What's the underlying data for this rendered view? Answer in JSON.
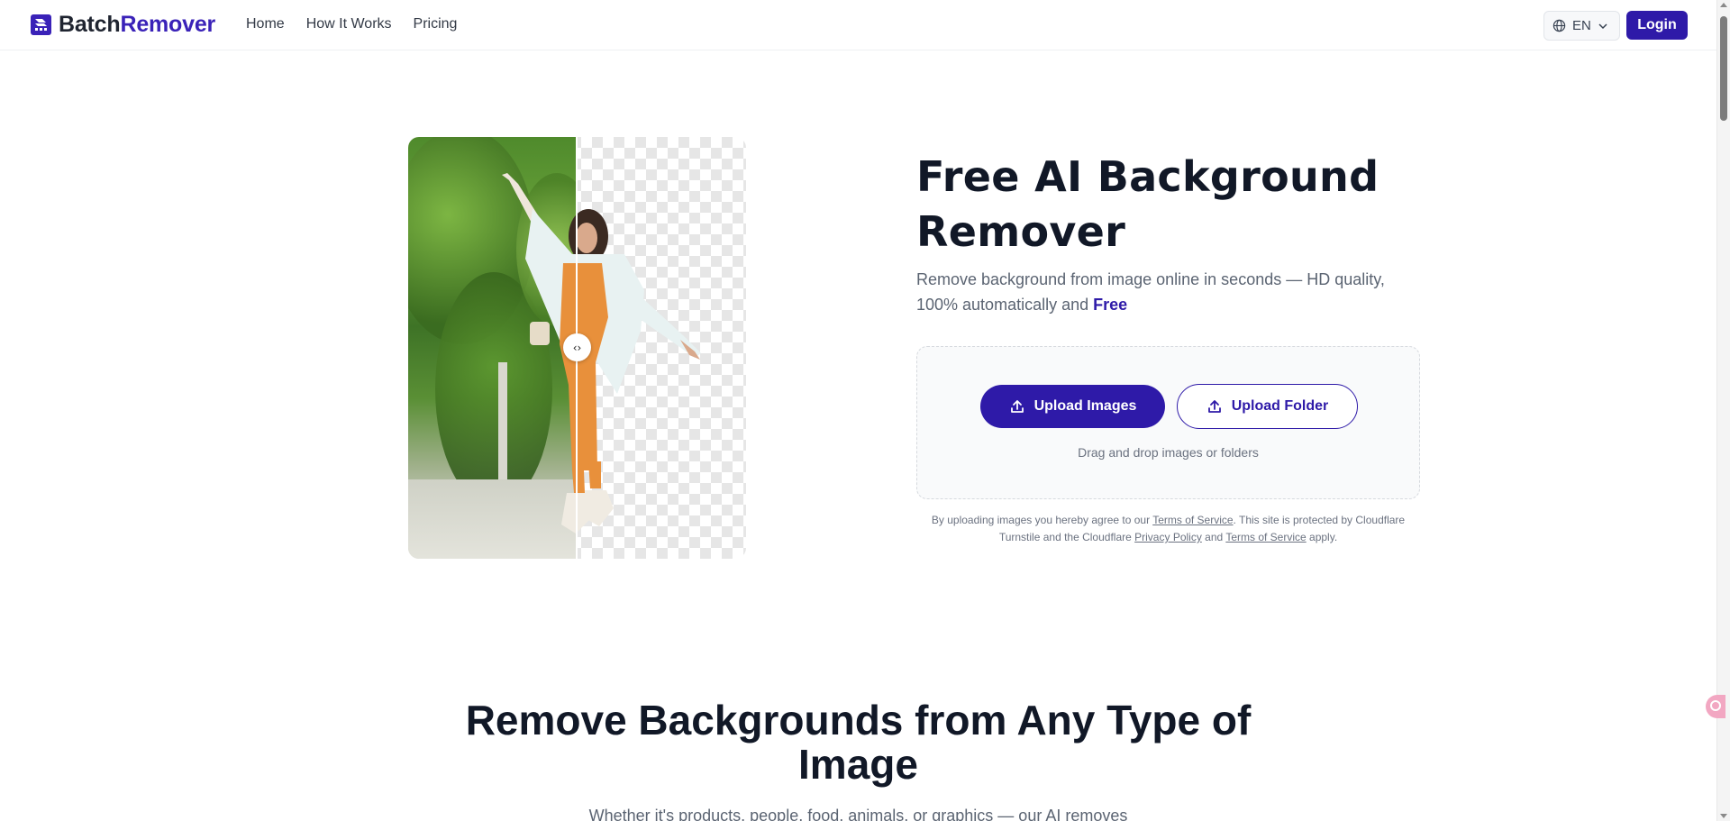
{
  "brand": {
    "part1": "Batch",
    "part2": "Remover"
  },
  "nav": {
    "items": [
      "Home",
      "How It Works",
      "Pricing"
    ]
  },
  "header": {
    "language": "EN",
    "login_label": "Login"
  },
  "hero": {
    "title": "Free AI Background Remover",
    "subtitle_main": "Remove background from image online in seconds — HD quality, 100% automatically and",
    "subtitle_free": "Free",
    "upload_images_label": "Upload Images",
    "upload_folder_label": "Upload Folder",
    "drop_hint": "Drag and drop images or folders",
    "legal": {
      "part1": "By uploading images you hereby agree to our",
      "link1": "Terms of Service",
      "part2": ". This site is protected by Cloudflare Turnstile and the Cloudflare",
      "link2": "Privacy Policy",
      "part3": "and",
      "link3": "Terms of Service",
      "part4": "apply."
    }
  },
  "section2": {
    "title": "Remove Backgrounds from Any Type of Image",
    "subtitle": "Whether it's products, people, food, animals, or graphics — our AI removes"
  },
  "colors": {
    "brand": "#2e1aa8",
    "text": "#111827",
    "muted": "#5b6472"
  },
  "icons": [
    "logo-icon",
    "globe-icon",
    "chevron-down-icon",
    "upload-icon",
    "compare-handle-icon"
  ]
}
